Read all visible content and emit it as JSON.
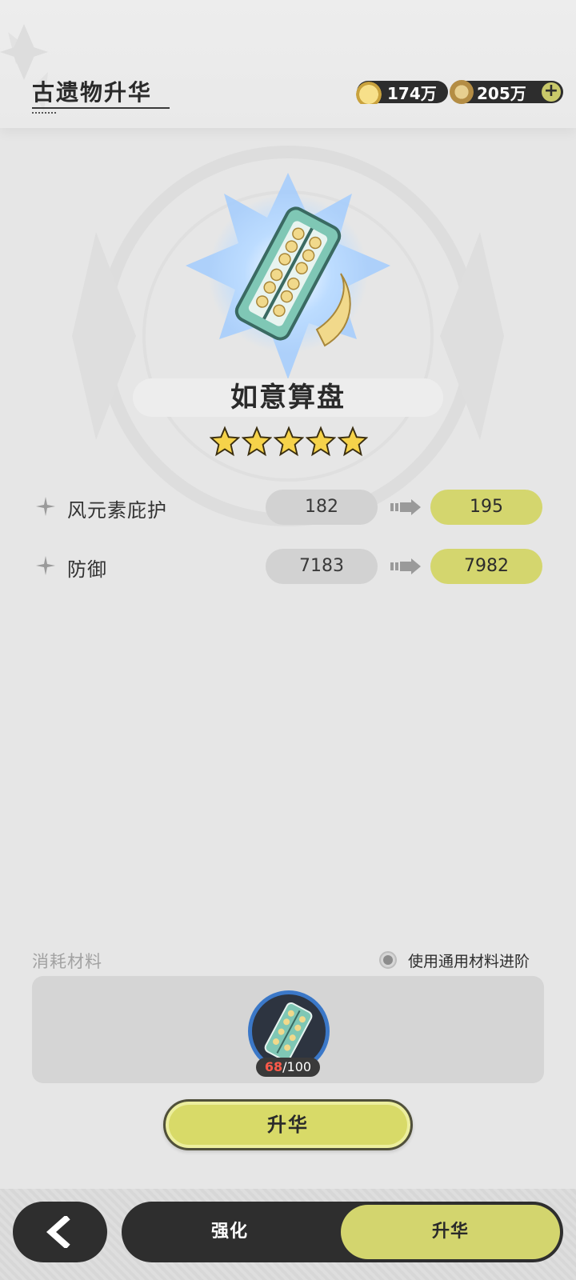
{
  "header": {
    "title": "古遗物升华",
    "currencies": [
      {
        "icon": "material-pile-icon",
        "amount": "174万"
      },
      {
        "icon": "coin-icon",
        "amount": "205万",
        "add": "+"
      }
    ]
  },
  "relic": {
    "name": "如意算盘",
    "stars": 5
  },
  "stats": [
    {
      "label": "风元素庇护",
      "current": "182",
      "next": "195"
    },
    {
      "label": "防御",
      "current": "7183",
      "next": "7982"
    }
  ],
  "materials": {
    "label": "消耗材料",
    "generic_toggle": "使用通用材料进阶",
    "item_have": "68",
    "item_need": "/100"
  },
  "actions": {
    "ascend_button": "升华"
  },
  "bottom_nav": {
    "tabs": [
      "强化",
      "升华"
    ],
    "active": "升华"
  },
  "colors": {
    "accent": "#d4d66e",
    "dark": "#2e2e2e",
    "warning": "#ff5a4a"
  }
}
